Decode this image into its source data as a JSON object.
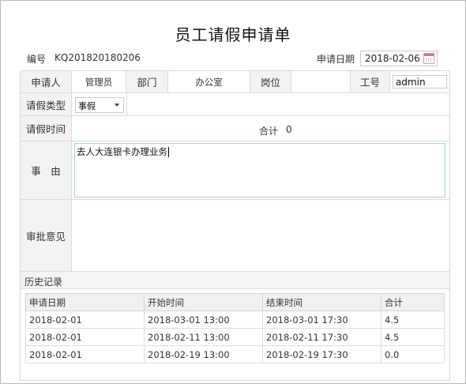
{
  "form_title": "员工请假申请单",
  "meta": {
    "number_label": "编号",
    "number_value": "KQ201820180206",
    "date_label": "申请日期",
    "date_value": "2018-02-06"
  },
  "row1": {
    "applicant_label": "申请人",
    "applicant_value": "管理员",
    "dept_label": "部门",
    "dept_value": "办公室",
    "post_label": "岗位",
    "post_value": "",
    "empno_label": "工号",
    "empno_value": "admin"
  },
  "row2": {
    "type_label": "请假类型",
    "type_value": "事假"
  },
  "row3": {
    "time_label": "请假时间",
    "total_label": "合计",
    "total_value": "0"
  },
  "row4": {
    "reason_label": "事　由",
    "reason_value": "去人大连银卡办理业务"
  },
  "row5": {
    "approval_label": "审批意见"
  },
  "history": {
    "label": "历史记录",
    "columns": [
      "申请日期",
      "开始时间",
      "结束时间",
      "合计"
    ],
    "rows": [
      [
        "2018-02-01",
        "2018-03-01 13:00",
        "2018-03-01 17:30",
        "4.5"
      ],
      [
        "2018-02-01",
        "2018-02-11 13:00",
        "2018-02-11 17:30",
        "4.5"
      ],
      [
        "2018-02-01",
        "2018-02-19 13:00",
        "2018-02-19 17:30",
        "0.0"
      ]
    ]
  },
  "icons": {
    "calendar": "calendar-icon",
    "dropdown": "chevron-down-icon"
  }
}
